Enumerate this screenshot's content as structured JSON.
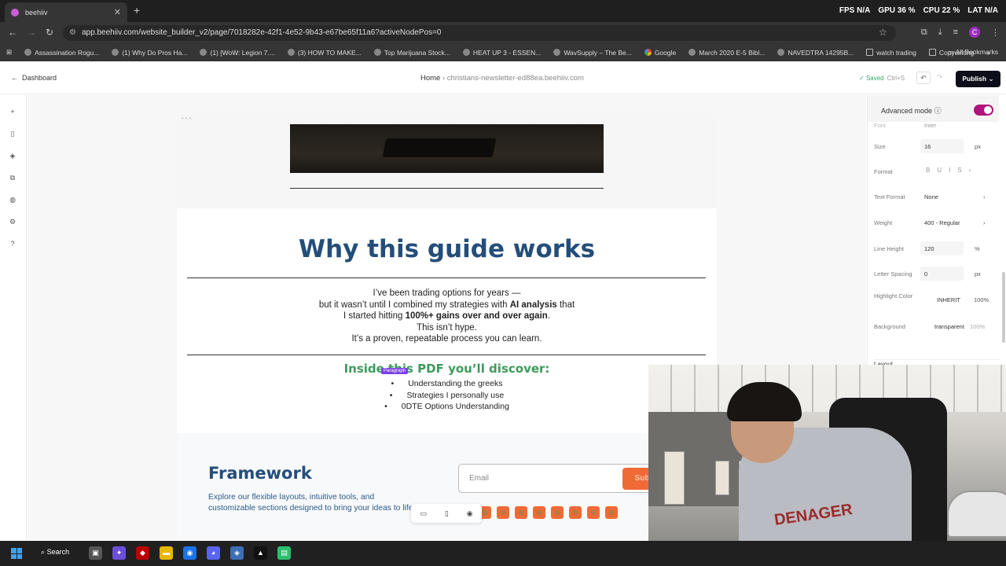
{
  "browser": {
    "tab_title": "beehiiv",
    "url": "app.beehiiv.com/website_builder_v2/page/7018282e-42f1-4e52-9b43-e67be65f11a6?activeNodePos=0",
    "stats": {
      "fps_label": "FPS",
      "fps": "N/A",
      "gpu_label": "GPU",
      "gpu": "36 %",
      "cpu_label": "CPU",
      "cpu": "22 %",
      "lat_label": "LAT",
      "lat": "N/A"
    },
    "profile_initial": "C",
    "bookmarks": [
      {
        "label": "Assassination Rogu...",
        "icon": "globe-icon"
      },
      {
        "label": "(1) Why Do Pros Ha...",
        "icon": "globe-icon"
      },
      {
        "label": "(1) [WoW: Legion 7....",
        "icon": "globe-icon"
      },
      {
        "label": "(3) HOW TO MAKE...",
        "icon": "globe-icon"
      },
      {
        "label": "Top Marijuana Stock...",
        "icon": "globe-icon"
      },
      {
        "label": "HEAT UP 3 - ESSEN...",
        "icon": "globe-icon"
      },
      {
        "label": "WavSupply – The Be...",
        "icon": "globe-icon"
      },
      {
        "label": "Google",
        "icon": "google-icon"
      },
      {
        "label": "March 2020 E-5 Bibl...",
        "icon": "globe-icon"
      },
      {
        "label": "NAVEDTRA 14295B...",
        "icon": "globe-icon"
      },
      {
        "label": "watch trading",
        "icon": "folder-icon"
      },
      {
        "label": "Copywriting",
        "icon": "folder-icon"
      }
    ],
    "all_bookmarks": "All Bookmarks"
  },
  "header": {
    "back_label": "Dashboard",
    "crumb_home": "Home",
    "crumb_site": "christians-newsletter-ed88ea.beehiiv.com",
    "saved": "Saved",
    "saved_shortcut": "Ctrl+S",
    "publish": "Publish"
  },
  "page": {
    "heading": "Why this guide works",
    "body_lines": [
      "I’ve been trading options for years —",
      "but it wasn’t until I combined my strategies with ",
      "AI analysis",
      " that",
      "I started hitting ",
      "100%+ gains over and over again",
      ".",
      "This isn’t hype.",
      "It’s a proven, repeatable process you can learn."
    ],
    "subheading": "Inside this PDF you’ll discover:",
    "paragraph_tag": "Paragraph",
    "list": [
      "Understanding the greeks",
      "Strategies I personally use",
      "0DTE Options Understanding"
    ]
  },
  "footer": {
    "title": "Framework",
    "text": "Explore our flexible layouts, intuitive tools, and customizable sections designed to bring your ideas to life.",
    "email_placeholder": "Email",
    "subscribe": "Sub"
  },
  "panel": {
    "advanced_mode": "Advanced mode",
    "font_label": "Font",
    "font_value": "Inter",
    "size_label": "Size",
    "size_value": "16",
    "size_unit": "px",
    "format_label": "Format",
    "text_format_label": "Text Format",
    "text_format_value": "None",
    "weight_label": "Weight",
    "weight_value": "400 - Regular",
    "line_height_label": "Line Height",
    "line_height_value": "120",
    "line_height_unit": "%",
    "letter_spacing_label": "Letter Spacing",
    "letter_spacing_value": "0",
    "letter_spacing_unit": "px",
    "highlight_label": "Highlight Color",
    "highlight_value": "INHERIT",
    "highlight_pct": "100%",
    "background_label": "Background",
    "background_value": "transparent",
    "background_pct": "100%",
    "layout_label": "Layout"
  },
  "webcam": {
    "shirt_text": "DENAGER"
  },
  "taskbar": {
    "search_label": "Search"
  },
  "colors": {
    "heading": "#244e7a",
    "green": "#3d9a5c",
    "publish_bg": "#0e0e1a",
    "toggle": "#b0137d",
    "accent_orange": "#f06a36"
  }
}
